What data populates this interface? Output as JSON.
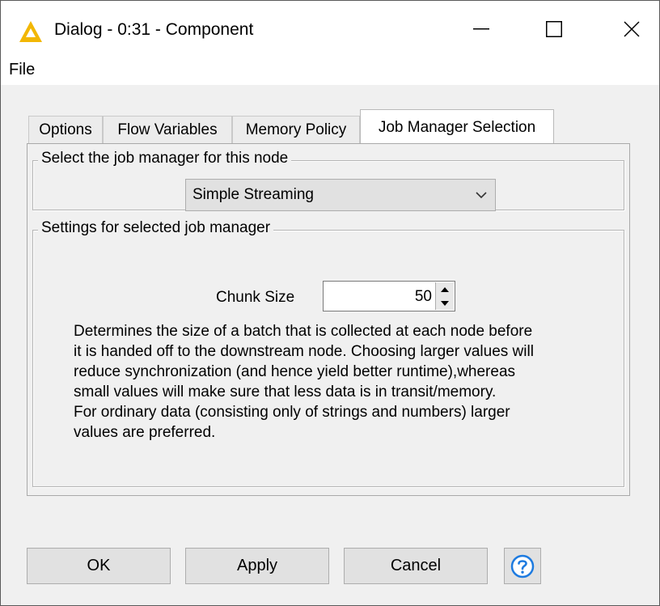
{
  "window": {
    "title": "Dialog - 0:31 - Component",
    "icon": "knime-triangle-icon",
    "accent_color": "#f2b705"
  },
  "menubar": {
    "file_label": "File"
  },
  "tabs": [
    {
      "label": "Options",
      "active": false
    },
    {
      "label": "Flow Variables",
      "active": false
    },
    {
      "label": "Memory Policy",
      "active": false
    },
    {
      "label": "Job Manager Selection",
      "active": true
    }
  ],
  "job_manager": {
    "legend": "Select the job manager for this node",
    "selected": "Simple Streaming"
  },
  "settings": {
    "legend": "Settings for selected job manager",
    "chunk_size_label": "Chunk Size",
    "chunk_size_value": "50",
    "description_lines": [
      "Determines the size of a batch that is collected at each node before",
      "it is handed off to the downstream node. Choosing larger values will",
      "reduce synchronization (and hence yield better runtime),whereas",
      "small values will make sure that less data is in transit/memory.",
      "For ordinary data (consisting only of strings and numbers) larger",
      "values are preferred."
    ]
  },
  "buttons": {
    "ok": "OK",
    "apply": "Apply",
    "cancel": "Cancel",
    "help_icon": "help-question-icon",
    "help_color": "#1e7be0"
  }
}
